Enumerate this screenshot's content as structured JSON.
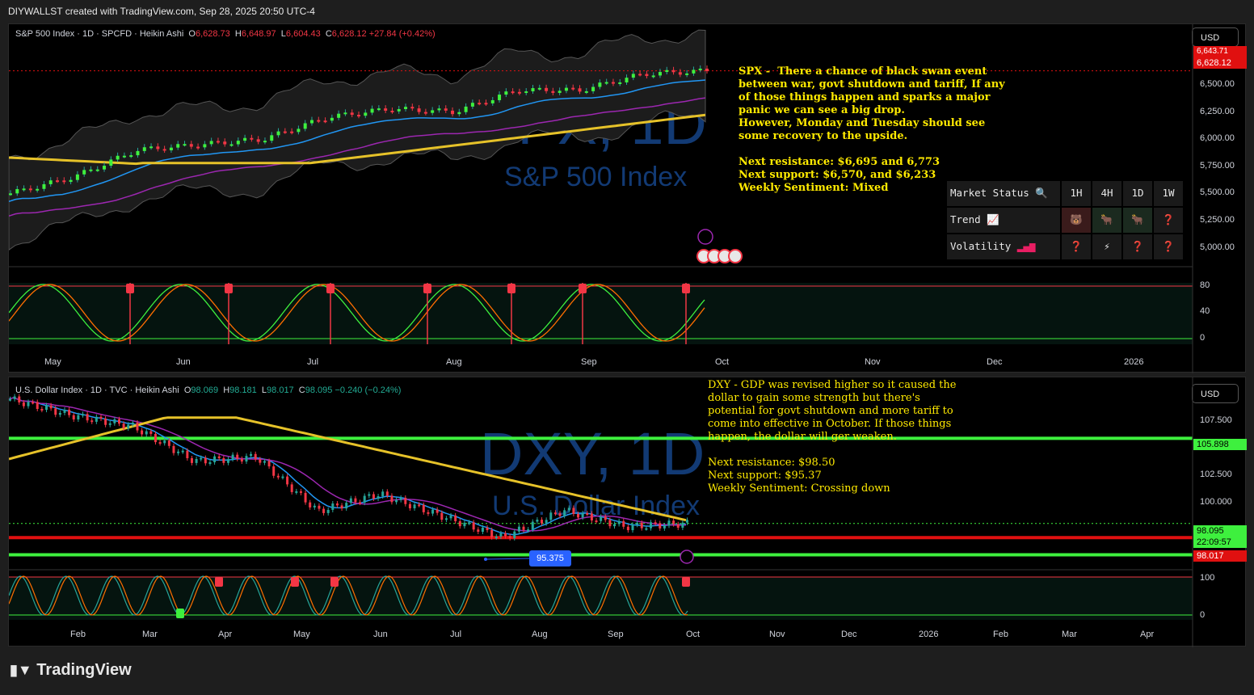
{
  "header": {
    "text": "DIYWALLST created with TradingView.com, Sep 28, 2025 20:50 UTC-4"
  },
  "footer": {
    "brand": "TradingView"
  },
  "charts": {
    "spx": {
      "legend_name": "S&P 500 Index · 1D · SPCFD · Heikin Ashi",
      "O": "6,628.73",
      "H": "6,648.97",
      "L": "6,604.43",
      "C": "6,628.12",
      "chg": "+27.84 (+0.42%)",
      "currency": "USD",
      "price_labels": [
        "6,500.00",
        "6,250.00",
        "6,000.00",
        "5,750.00",
        "5,500.00",
        "5,250.00",
        "5,000.00"
      ],
      "last_price": "6,628.12",
      "top_partial": "6,643.71",
      "osc_labels": [
        "80",
        "40",
        "0"
      ],
      "months": [
        "May",
        "Jun",
        "Jul",
        "Aug",
        "Sep",
        "Oct",
        "Nov",
        "Dec",
        "2026"
      ],
      "watermark_big": "SPX, 1D",
      "watermark_small": "S&P 500 Index",
      "note": "SPX -  There a chance of black swan event\nbetween war, govt shutdown and tariff, If any\nof those things happen and sparks a major\npanic we can see a big drop.\nHowever, Monday and Tuesday should see\nsome recovery to the upside.\n\nNext resistance: $6,695 and 6,773\nNext support: $6,570, and $6,233\nWeekly Sentiment: Mixed"
    },
    "dxy": {
      "legend_name": "U.S. Dollar Index · 1D · TVC · Heikin Ashi",
      "O": "98.069",
      "H": "98.181",
      "L": "98.017",
      "C": "98.095",
      "chg": "−0.240 (−0.24%)",
      "currency": "USD",
      "price_labels": [
        "107.500",
        "105.000",
        "102.500",
        "100.000"
      ],
      "resistance_badge": "105.898",
      "last_price": "98.095",
      "countdown": "22:09:57",
      "low_badge": "98.017",
      "marker_label": "95.375",
      "osc_labels": [
        "100",
        "0"
      ],
      "months": [
        "Feb",
        "Mar",
        "Apr",
        "May",
        "Jun",
        "Jul",
        "Aug",
        "Sep",
        "Oct",
        "Nov",
        "Dec",
        "2026",
        "Feb",
        "Mar",
        "Apr"
      ],
      "watermark_big": "DXY, 1D",
      "watermark_small": "U.S. Dollar Index",
      "note": "DXY - GDP was revised higher so it caused the\ndollar to gain some strength but there's\npotential for govt shutdown and more tariff to\ncome into effective in October. If those things\nhappen, the dollar will ger weaken.\n\nNext resistance: $98.50\nNext support: $95.37\nWeekly Sentiment: Crossing down"
    }
  },
  "market_status": {
    "title": "Market Status",
    "timeframes": [
      "1H",
      "4H",
      "1D",
      "1W"
    ],
    "rows": [
      {
        "label": "Trend",
        "icon": "chart-up-icon",
        "cells": [
          "🐻",
          "🐂",
          "🐂",
          "❓"
        ]
      },
      {
        "label": "Volatility",
        "icon": "signal-bars-icon",
        "cells": [
          "❓",
          "⚡",
          "❓",
          "❓"
        ]
      }
    ]
  },
  "chart_data": [
    {
      "type": "candlestick",
      "title": "S&P 500 Index · 1D · SPCFD · Heikin Ashi",
      "x": [
        "Apr 25",
        "May 1",
        "May 15",
        "Jun 1",
        "Jun 15",
        "Jul 1",
        "Jul 15",
        "Aug 1",
        "Aug 15",
        "Sep 1",
        "Sep 15",
        "Sep 26"
      ],
      "close": [
        5500,
        5650,
        5900,
        5950,
        6000,
        6200,
        6280,
        6250,
        6450,
        6450,
        6600,
        6628.12
      ],
      "ylim": [
        4900,
        6700
      ],
      "series": [
        {
          "name": "MA fast",
          "color": "#2196f3"
        },
        {
          "name": "MA mid",
          "color": "#9c27b0"
        },
        {
          "name": "MA slow",
          "color": "#e6c229"
        }
      ],
      "levels": {
        "resistance": [
          6695,
          6773
        ],
        "support": [
          6570,
          6233
        ]
      }
    },
    {
      "type": "candlestick",
      "title": "U.S. Dollar Index · 1D · TVC · Heikin Ashi",
      "x": [
        "Jan 13",
        "Feb 1",
        "Mar 1",
        "Mar 15",
        "Apr 1",
        "Apr 20",
        "May 15",
        "Jun 15",
        "Jul 1",
        "Aug 1",
        "Sep 1",
        "Sep 26"
      ],
      "close": [
        109.5,
        108.0,
        107.0,
        103.8,
        104.2,
        99.2,
        100.8,
        98.8,
        96.8,
        99.3,
        97.8,
        98.095
      ],
      "ylim": [
        94,
        110
      ],
      "levels": {
        "resistance": [
          105.898,
          98.5
        ],
        "support": [
          95.37
        ]
      }
    }
  ],
  "colors": {
    "up": "#26a69a",
    "down": "#f23645",
    "ma_slow": "#e6c229",
    "level_green": "#3ef03e",
    "level_red": "#e01010",
    "note": "#ffea00",
    "watermark": "#123a74"
  }
}
